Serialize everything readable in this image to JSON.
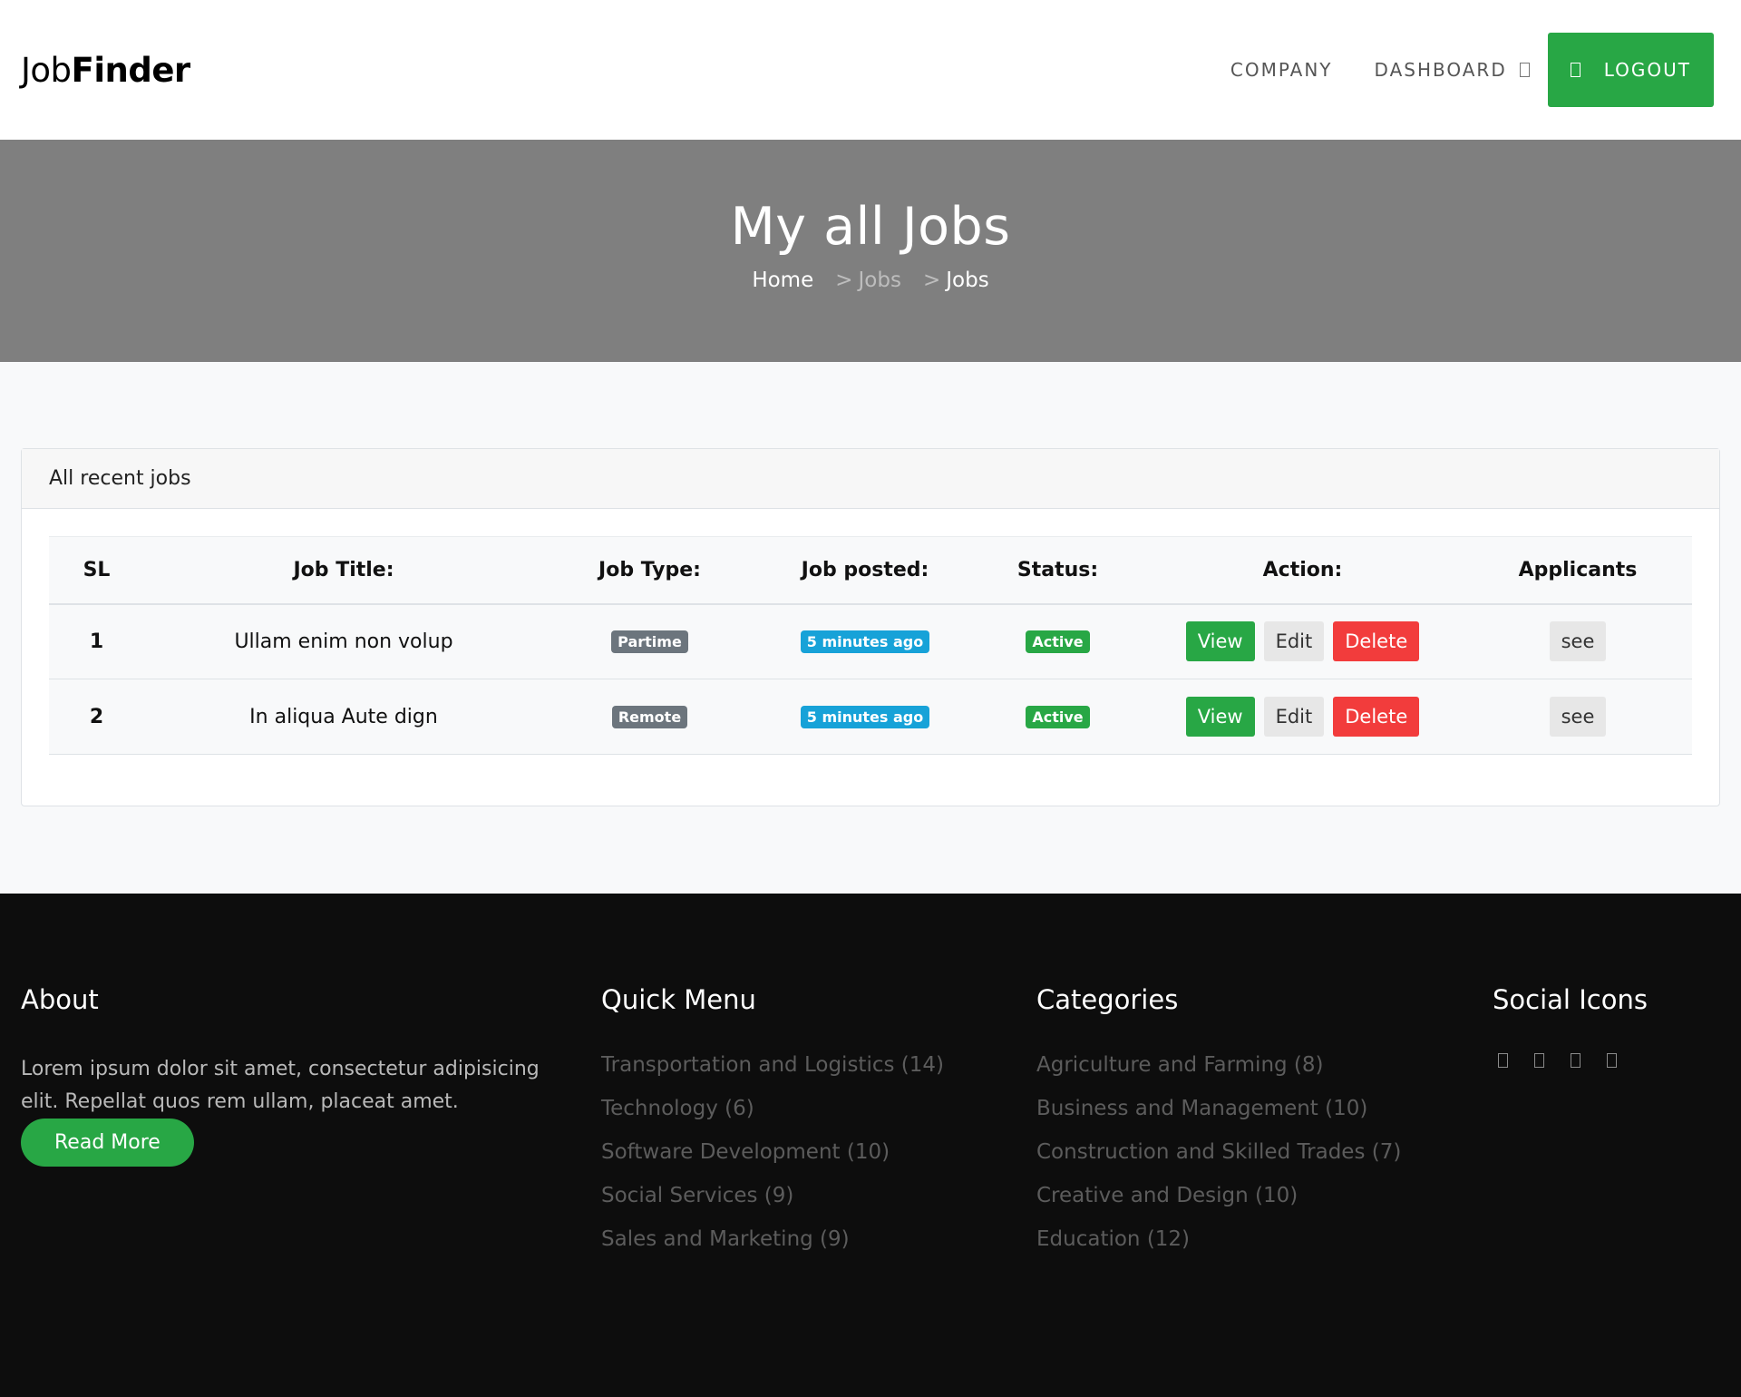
{
  "header": {
    "logo_light": "Job",
    "logo_bold": "Finder",
    "nav": {
      "company": "COMPANY",
      "dashboard": "DASHBOARD",
      "logout": "LOGOUT"
    }
  },
  "hero": {
    "title": "My all Jobs",
    "breadcrumb": {
      "home": "Home",
      "sep1": ">",
      "mid": "Jobs",
      "sep2": ">",
      "current": "Jobs"
    }
  },
  "card": {
    "title": "All recent jobs",
    "columns": [
      "SL",
      "Job Title:",
      "Job Type:",
      "Job posted:",
      "Status:",
      "Action:",
      "Applicants"
    ],
    "rows": [
      {
        "sl": "1",
        "title": "Ullam enim non volup",
        "type": "Partime",
        "posted": "5 minutes ago",
        "status": "Active"
      },
      {
        "sl": "2",
        "title": "In aliqua Aute dign",
        "type": "Remote",
        "posted": "5 minutes ago",
        "status": "Active"
      }
    ],
    "actions": {
      "view": "View",
      "edit": "Edit",
      "delete": "Delete",
      "see": "see"
    }
  },
  "footer": {
    "about": {
      "heading": "About",
      "text": "Lorem ipsum dolor sit amet, consectetur adipisicing elit. Repellat quos rem ullam, placeat amet.",
      "button": "Read More"
    },
    "quick_menu": {
      "heading": "Quick Menu",
      "items": [
        "Transportation and Logistics (14)",
        "Technology (6)",
        "Software Development (10)",
        "Social Services (9)",
        "Sales and Marketing (9)"
      ]
    },
    "categories": {
      "heading": "Categories",
      "items": [
        "Agriculture and Farming (8)",
        "Business and Management (10)",
        "Construction and Skilled Trades (7)",
        "Creative and Design (10)",
        "Education (12)"
      ]
    },
    "social": {
      "heading": "Social Icons",
      "icons": [
        "social-icon-1",
        "social-icon-2",
        "social-icon-3",
        "social-icon-4"
      ]
    }
  },
  "colors": {
    "accent": "#28a745",
    "danger": "#f23c3c",
    "info": "#17a2d8",
    "hero_bg": "#7f7f7f",
    "footer_bg": "#0d0d0d"
  }
}
